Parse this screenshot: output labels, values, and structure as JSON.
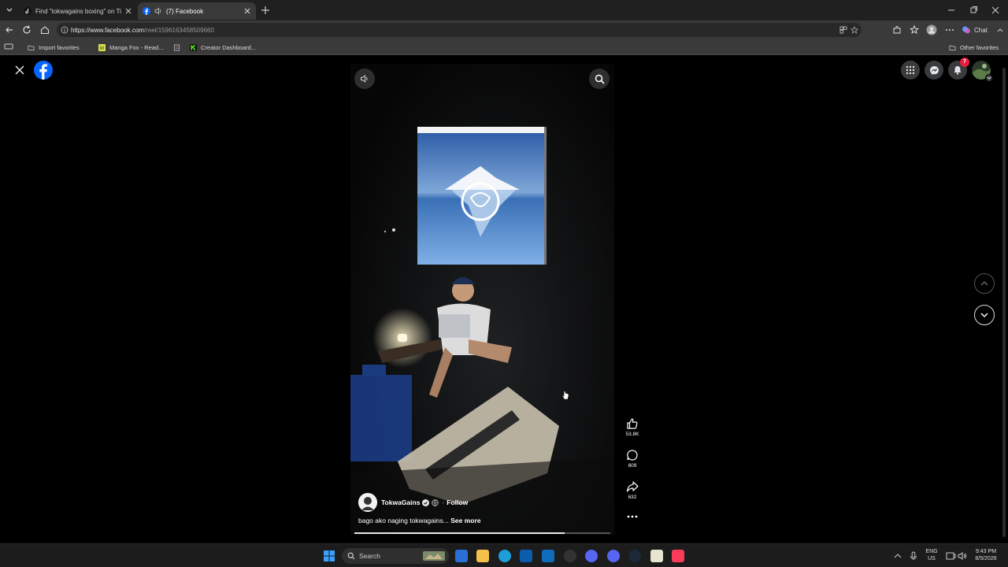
{
  "browser": {
    "tabs": [
      {
        "title": "Find \"tokwagains boxing\" on TikTo"
      },
      {
        "title": "(7) Facebook"
      }
    ],
    "url_host": "https://www.facebook.com",
    "url_path": "/reel/1596163458509660",
    "bookmarks": [
      {
        "label": "Import favorites"
      },
      {
        "label": "Manga Fox - Read..."
      },
      {
        "label": "Creator Dashboard..."
      }
    ],
    "other_favorites": "Other favorites",
    "chat_label": "Chat"
  },
  "facebook": {
    "notification_count": "7",
    "reel": {
      "author": "TokwaGains",
      "follow_label": "Follow",
      "separator": "·",
      "caption": "bago ako naging tokwagains... ",
      "see_more": "See more",
      "likes": "53.8K",
      "comments": "609",
      "shares": "632",
      "progress_fraction": 0.82
    }
  },
  "taskbar": {
    "search_placeholder": "Search",
    "lang_top": "ENG",
    "lang_bottom": "US",
    "time": "9:43 PM",
    "date": "8/5/2026"
  },
  "colors": {
    "facebook_blue": "#0866ff",
    "notification_red": "#e41e3f",
    "chrome_dark": "#202020",
    "toolbar": "#3a3a3a"
  }
}
